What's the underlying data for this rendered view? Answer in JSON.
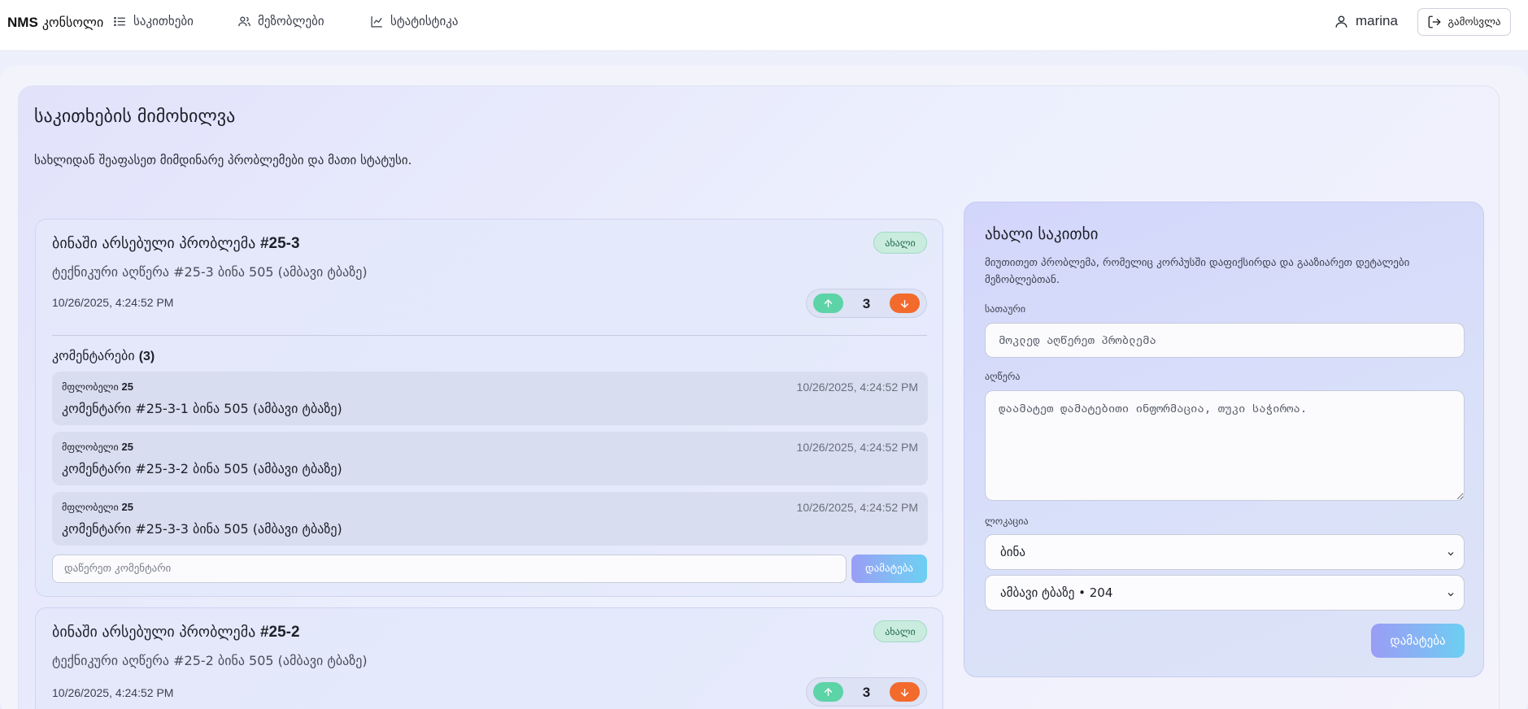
{
  "nav": {
    "brand_bold": "NMS",
    "brand_rest": "კონსოლი",
    "items": [
      {
        "label": "საკითხები",
        "icon": "list-icon"
      },
      {
        "label": "მეზობლები",
        "icon": "users-icon"
      },
      {
        "label": "სტატისტიკა",
        "icon": "chart-icon"
      }
    ],
    "user": "marina",
    "logout_label": "გამოსვლა"
  },
  "page": {
    "title": "საკითხების მიმოხილვა",
    "subtitle": "სახლიდან შეაფასეთ მიმდინარე პრობლემები და მათი სტატუსი."
  },
  "issues": [
    {
      "title_prefix": "ბინაში არსებული პრობლემა",
      "title_id": "#25-3",
      "status": "ახალი",
      "description": "ტექნიკური აღწერა #25-3 ბინა 505 (ამბავი ტბაზე)",
      "date": "10/26/2025, 4:24:52 PM",
      "votes": "3",
      "comments_label": "კომენტარები",
      "comments_count": "(3)",
      "comments": [
        {
          "author_prefix": "მფლობელი",
          "author_num": "25",
          "time": "10/26/2025, 4:24:52 PM",
          "text": "კომენტარი #25-3-1 ბინა 505 (ამბავი ტბაზე)"
        },
        {
          "author_prefix": "მფლობელი",
          "author_num": "25",
          "time": "10/26/2025, 4:24:52 PM",
          "text": "კომენტარი #25-3-2 ბინა 505 (ამბავი ტბაზე)"
        },
        {
          "author_prefix": "მფლობელი",
          "author_num": "25",
          "time": "10/26/2025, 4:24:52 PM",
          "text": "კომენტარი #25-3-3 ბინა 505 (ამბავი ტბაზე)"
        }
      ],
      "comment_placeholder": "დაწერეთ კომენტარი",
      "comment_button": "დამატება"
    },
    {
      "title_prefix": "ბინაში არსებული პრობლემა",
      "title_id": "#25-2",
      "status": "ახალი",
      "description": "ტექნიკური აღწერა #25-2 ბინა 505 (ამბავი ტბაზე)",
      "date": "10/26/2025, 4:24:52 PM",
      "votes": "3"
    }
  ],
  "new_issue": {
    "title": "ახალი საკითხი",
    "description": "მიუთითეთ პრობლემა, რომელიც კორპუსში დაფიქსირდა და გააზიარეთ დეტალები მეზობლებთან.",
    "title_label": "სათაური",
    "title_placeholder": "მოკლედ აღწერეთ პრობლემა",
    "desc_label": "აღწერა",
    "desc_placeholder": "დაამატეთ დამატებითი ინფორმაცია, თუკი საჭიროა.",
    "location_label": "ლოკაცია",
    "location_type": "ბინა",
    "location_value": "ამბავი ტბაზე • 204",
    "submit": "დამატება"
  },
  "colors": {
    "accent_up": "#5dd3a8",
    "accent_down": "#f26a2c",
    "badge_bg": "#c9ecdf",
    "button_gradient_start": "#9a9df5",
    "button_gradient_end": "#6ccff2"
  }
}
